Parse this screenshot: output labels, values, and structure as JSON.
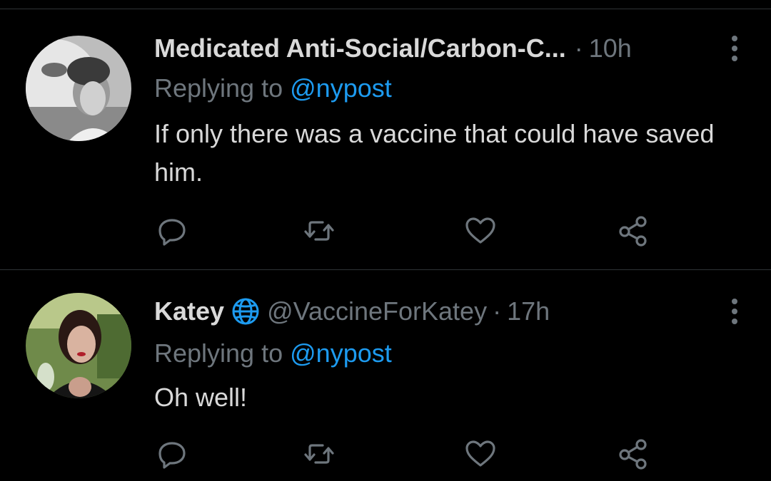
{
  "colors": {
    "background": "#000000",
    "divider": "#2f3336",
    "text_primary": "#d9d9d9",
    "text_secondary": "#6e767d",
    "link": "#1d9bf0"
  },
  "tweets": [
    {
      "display_name": "Medicated Anti-Social/Carbon-C...",
      "handle": "",
      "separator": "·",
      "time": "10h",
      "replying_prefix": "Replying to",
      "replying_to": "@nypost",
      "text": "If only there was a vaccine that could have saved him.",
      "verified_icon": null,
      "actions": [
        "reply-icon",
        "retweet-icon",
        "like-icon",
        "share-icon"
      ]
    },
    {
      "display_name": "Katey",
      "handle": "@VaccineForKatey",
      "separator": "·",
      "time": "17h",
      "replying_prefix": "Replying to",
      "replying_to": "@nypost",
      "text": "Oh well!",
      "verified_icon": "globe-icon",
      "actions": [
        "reply-icon",
        "retweet-icon",
        "like-icon",
        "share-icon"
      ]
    }
  ]
}
